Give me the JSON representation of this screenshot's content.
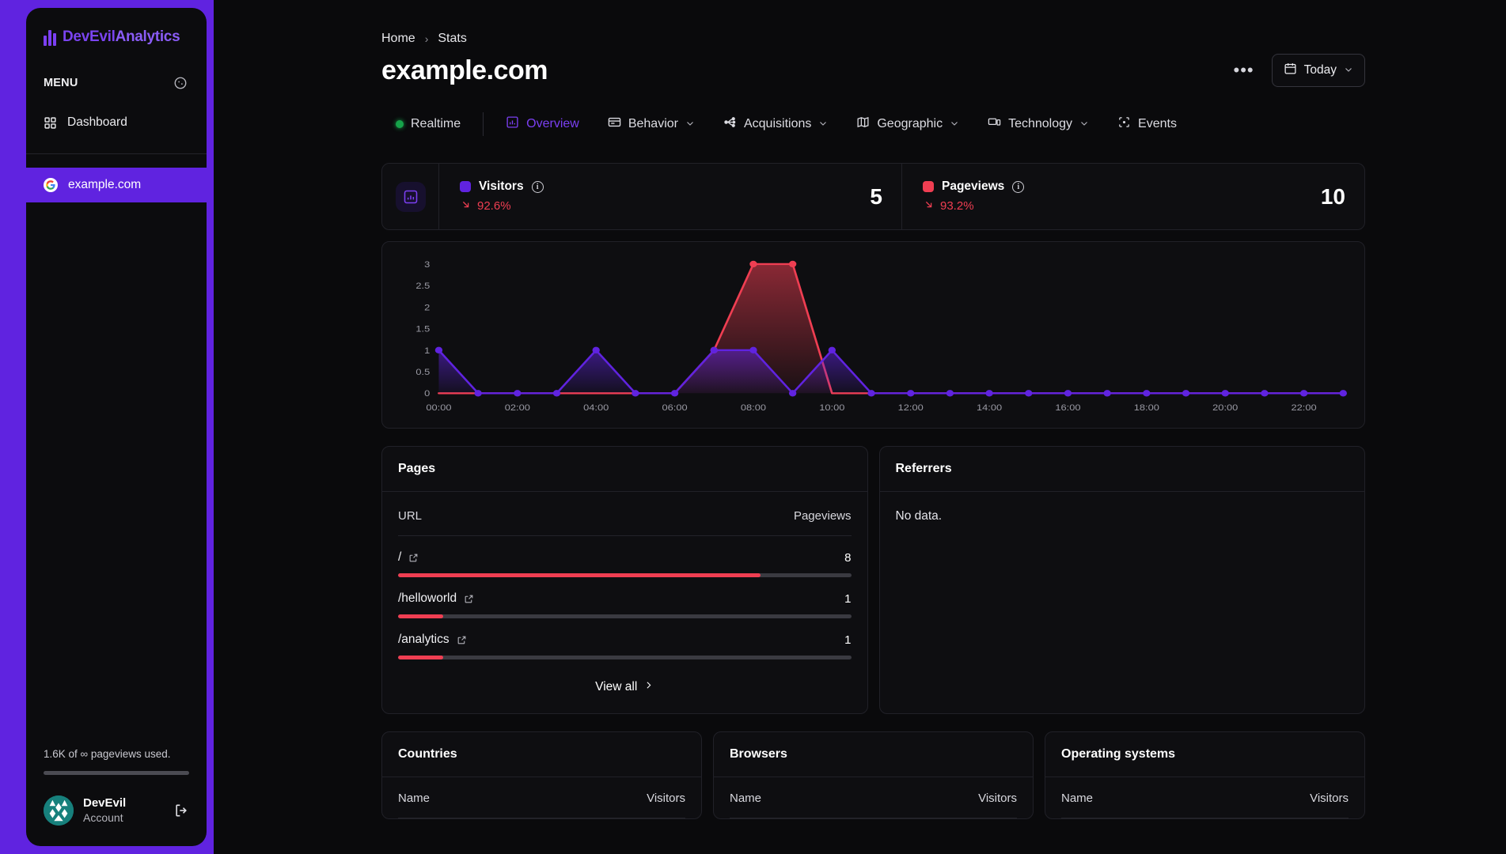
{
  "brand": {
    "name_bold": "DevEvil",
    "name_light": "Analytics",
    "icon": "bar-chart-icon"
  },
  "sidebar": {
    "menu_label": "MENU",
    "menu_icon": "palette-icon",
    "nav": [
      {
        "label": "Dashboard",
        "icon": "grid-icon"
      }
    ],
    "site": {
      "label": "example.com",
      "icon": "google-favicon",
      "letter": "G"
    },
    "usage_text": "1.6K of ∞ pageviews used.",
    "usage_percent": 0,
    "account": {
      "name": "DevEvil",
      "sub": "Account",
      "logout_icon": "logout-icon"
    }
  },
  "header": {
    "breadcrumb": [
      "Home",
      "Stats"
    ],
    "breadcrumb_sep": "›",
    "title": "example.com",
    "more_label": "•••",
    "date_range": {
      "label": "Today",
      "icon": "calendar-icon",
      "chevron": "⌄"
    }
  },
  "tabs": [
    {
      "label": "Realtime",
      "icon": "live-dot-icon",
      "active": false,
      "chevron": ""
    },
    {
      "label": "Overview",
      "icon": "chart-icon",
      "active": true,
      "chevron": ""
    },
    {
      "label": "Behavior",
      "icon": "panel-icon",
      "active": false,
      "chevron": "⌄"
    },
    {
      "label": "Acquisitions",
      "icon": "branch-icon",
      "active": false,
      "chevron": "⌄"
    },
    {
      "label": "Geographic",
      "icon": "map-icon",
      "active": false,
      "chevron": "⌄"
    },
    {
      "label": "Technology",
      "icon": "device-icon",
      "active": false,
      "chevron": "⌄"
    },
    {
      "label": "Events",
      "icon": "target-icon",
      "active": false,
      "chevron": ""
    }
  ],
  "summary": {
    "icon": "stats-icon",
    "metrics": [
      {
        "name": "Visitors",
        "color": "#6023e0",
        "delta": "92.6%",
        "delta_dir": "down",
        "delta_color": "#ef3e52",
        "value": "5",
        "info": "i"
      },
      {
        "name": "Pageviews",
        "color": "#ef3e52",
        "delta": "93.2%",
        "delta_dir": "down",
        "delta_color": "#ef3e52",
        "value": "10",
        "info": "i"
      }
    ]
  },
  "chart_data": {
    "type": "area",
    "title": "",
    "xlabel": "",
    "ylabel": "",
    "ylim": [
      0,
      3
    ],
    "yticks": [
      "0",
      "0.5",
      "1",
      "1.5",
      "2",
      "2.5",
      "3"
    ],
    "grid": false,
    "legend": "top-summary-cards",
    "x": [
      "00:00",
      "01:00",
      "02:00",
      "03:00",
      "04:00",
      "05:00",
      "06:00",
      "07:00",
      "08:00",
      "09:00",
      "10:00",
      "11:00",
      "12:00",
      "13:00",
      "14:00",
      "15:00",
      "16:00",
      "17:00",
      "18:00",
      "19:00",
      "20:00",
      "21:00",
      "22:00",
      "23:00"
    ],
    "xtick_labels": [
      "00:00",
      "02:00",
      "04:00",
      "06:00",
      "08:00",
      "10:00",
      "12:00",
      "14:00",
      "16:00",
      "18:00",
      "20:00",
      "22:00"
    ],
    "series": [
      {
        "name": "Pageviews",
        "color": "#ef3e52",
        "values": [
          0,
          0,
          0,
          0,
          0,
          0,
          0,
          1,
          3,
          3,
          0,
          0,
          0,
          0,
          0,
          0,
          0,
          0,
          0,
          0,
          0,
          0,
          0,
          0
        ]
      },
      {
        "name": "Visitors",
        "color": "#6023e0",
        "values": [
          1,
          0,
          0,
          0,
          1,
          0,
          0,
          1,
          1,
          0,
          1,
          0,
          0,
          0,
          0,
          0,
          0,
          0,
          0,
          0,
          0,
          0,
          0,
          0
        ]
      }
    ]
  },
  "pages": {
    "title": "Pages",
    "columns": [
      "URL",
      "Pageviews"
    ],
    "rows": [
      {
        "url": "/",
        "count": "8",
        "percent": 80,
        "link_icon": "external-link-icon"
      },
      {
        "url": "/helloworld",
        "count": "1",
        "percent": 10,
        "link_icon": "external-link-icon"
      },
      {
        "url": "/analytics",
        "count": "1",
        "percent": 10,
        "link_icon": "external-link-icon"
      }
    ],
    "view_all": "View all",
    "view_all_chevron": "›"
  },
  "referrers": {
    "title": "Referrers",
    "empty": "No data."
  },
  "bottom_panels": [
    {
      "title": "Countries",
      "columns": [
        "Name",
        "Visitors"
      ]
    },
    {
      "title": "Browsers",
      "columns": [
        "Name",
        "Visitors"
      ]
    },
    {
      "title": "Operating systems",
      "columns": [
        "Name",
        "Visitors"
      ]
    }
  ],
  "colors": {
    "accent": "#6023e0",
    "danger": "#ef3e52",
    "bg": "#0a0a0c",
    "panel": "#0e0e11",
    "border": "#212128"
  }
}
